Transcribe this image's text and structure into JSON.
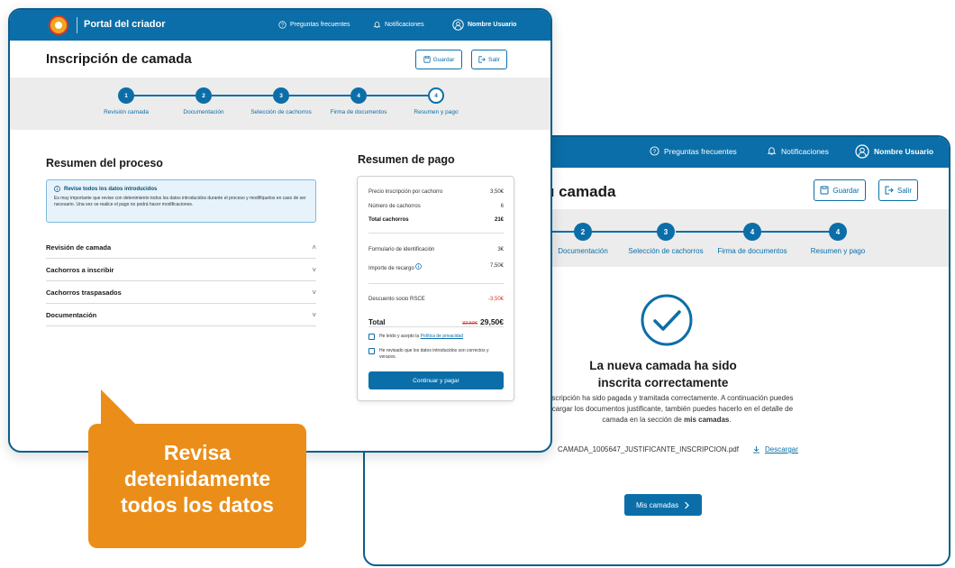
{
  "back_window": {
    "header": {
      "faq": "Preguntas frecuentes",
      "notifications": "Notificaciones",
      "user": "Nombre Usuario"
    },
    "title": "u camada",
    "save_label": "Guardar",
    "exit_label": "Salir",
    "steps": [
      {
        "number": "2",
        "label": "Documentación"
      },
      {
        "number": "3",
        "label": "Selección de cachorros"
      },
      {
        "number": "4",
        "label": "Firma de documentos"
      },
      {
        "number": "4",
        "label": "Resumen y pago"
      }
    ],
    "success_title": "La nueva camada ha sido inscrita correctamente",
    "success_desc_1": "a inscripción ha sido pagada y tramitada correctamente. A continuación puedes descargar los documentos justificante, también puedes hacerlo en el detalle de camada en la sección de ",
    "success_desc_bold": "mis camadas",
    "success_desc_2": ".",
    "file_name": "CAMADA_1005647_JUSTIFICANTE_INSCRIPCION.pdf",
    "download_label": "Descargar",
    "my_litters_label": "Mis camadas"
  },
  "front_window": {
    "header": {
      "portal_name": "Portal del criador",
      "faq": "Preguntas frecuentes",
      "notifications": "Notificaciones",
      "user": "Nombre Usuario"
    },
    "title": "Inscripción de camada",
    "save_label": "Guardar",
    "exit_label": "Salir",
    "steps": [
      {
        "number": "1",
        "label": "Revisión camada"
      },
      {
        "number": "2",
        "label": "Documentación"
      },
      {
        "number": "3",
        "label": "Selección de cachorros"
      },
      {
        "number": "4",
        "label": "Firma de documentos"
      },
      {
        "number": "4",
        "label": "Resumen y pago"
      }
    ],
    "process_summary_title": "Resumen del proceso",
    "info_title": "Revise todos los datos introducidos",
    "info_text": "Es muy importante que revise con detenimiento todos los datos introducidos durante el proceso y modifíquelos en caso de ser necesario. Una vez se realice el pago no podrá hacer modificaciones.",
    "accordions": [
      {
        "label": "Revisión de camada",
        "chevron": "˄"
      },
      {
        "label": "Cachorros a inscribir",
        "chevron": "˅"
      },
      {
        "label": "Cachorros traspasados",
        "chevron": "˅"
      },
      {
        "label": "Documentación",
        "chevron": "˅"
      }
    ],
    "payment_title": "Resumen de pago",
    "payment": {
      "price_label": "Precio inscripción por cachorro",
      "price_value": "3,50€",
      "count_label": "Número de cachorros",
      "count_value": "6",
      "total_puppies_label": "Total cachorros",
      "total_puppies_value": "21€",
      "form_label": "Formulario de identificación",
      "form_value": "3€",
      "surcharge_label": "Importe de recargo",
      "surcharge_value": "7,50€",
      "discount_label": "Descuento socio RSCE",
      "discount_value": "-3,50€",
      "total_label": "Total",
      "total_old": "32,50€",
      "total_new": "29,50€",
      "check1_text": "He leído y acepto la ",
      "check1_link": "Política de privacidad",
      "check2_text": "He revisado que los datos introducidos son correctos y veraces.",
      "pay_button": "Continuar y pagar"
    }
  },
  "callout": {
    "line1": "Revisa",
    "line2": "detenidamente",
    "line3": "todos los datos"
  },
  "colors": {
    "primary": "#0b6ea8",
    "accent_orange": "#ea8e19",
    "info_bg": "#e6f3fb",
    "discount_red": "#d23a2f"
  }
}
